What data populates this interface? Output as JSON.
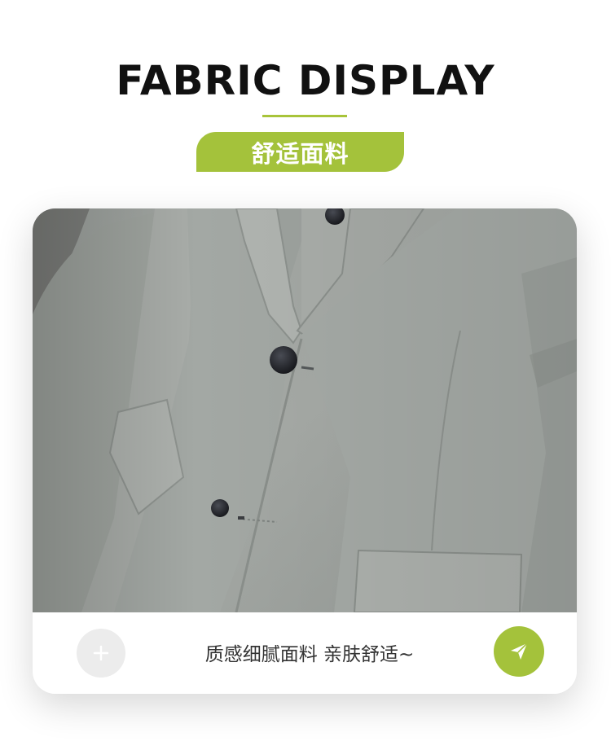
{
  "header": {
    "title": "FABRIC DISPLAY",
    "subtitle_badge": "舒适面料"
  },
  "colors": {
    "accent": "#a4c23b",
    "title_text": "#111111",
    "fabric_gray": "#a3a8a3"
  },
  "product_image": {
    "subject": "gray suit jacket close-up with lapel, buttons and flap pocket"
  },
  "caption_bar": {
    "text": "质感细腻面料 亲肤舒适~",
    "left_icon": "plus-icon",
    "right_icon": "send-icon"
  }
}
